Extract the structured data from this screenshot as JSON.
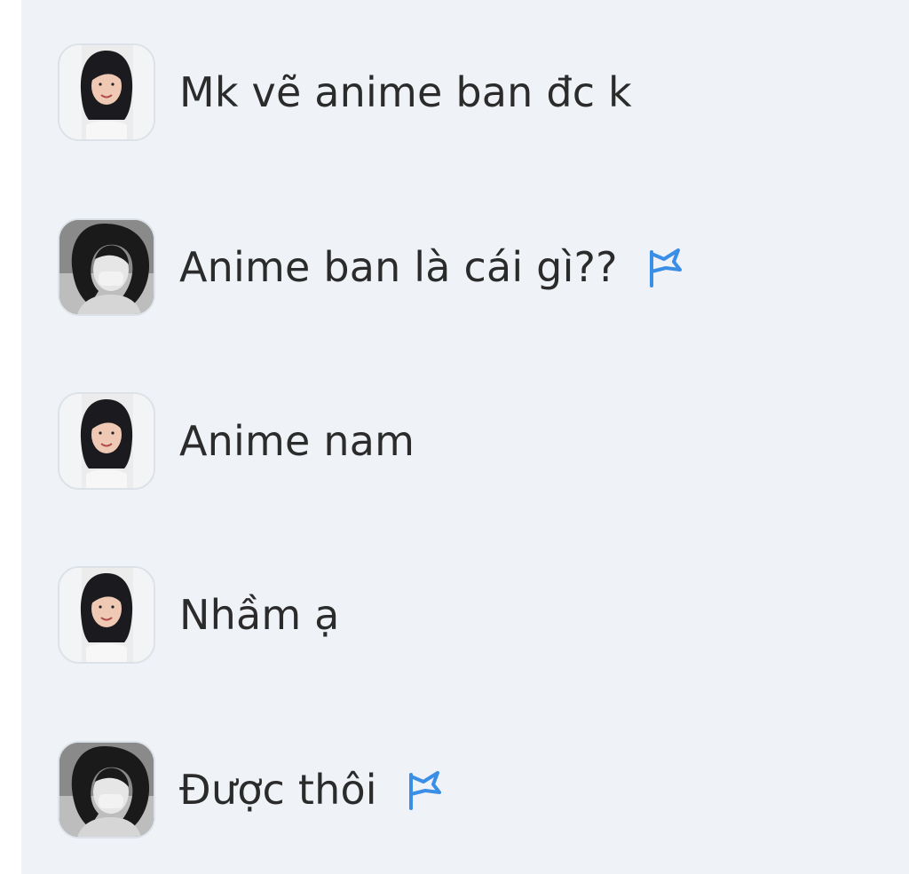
{
  "colors": {
    "background": "#eff3f8",
    "text": "#2b2b2b",
    "flag": "#3b8ee6"
  },
  "messages": [
    {
      "avatar": "user-girl-avatar",
      "text": "Mk vẽ anime ban đc k",
      "flag": false
    },
    {
      "avatar": "user-bw-avatar",
      "text": "Anime ban là cái gì??",
      "flag": true,
      "flag_icon": "flag-icon"
    },
    {
      "avatar": "user-girl-avatar",
      "text": "Anime nam",
      "flag": false
    },
    {
      "avatar": "user-girl-avatar",
      "text": "Nhầm ạ",
      "flag": false
    },
    {
      "avatar": "user-bw-avatar",
      "text": "Được thôi",
      "flag": true,
      "flag_icon": "flag-icon"
    }
  ]
}
